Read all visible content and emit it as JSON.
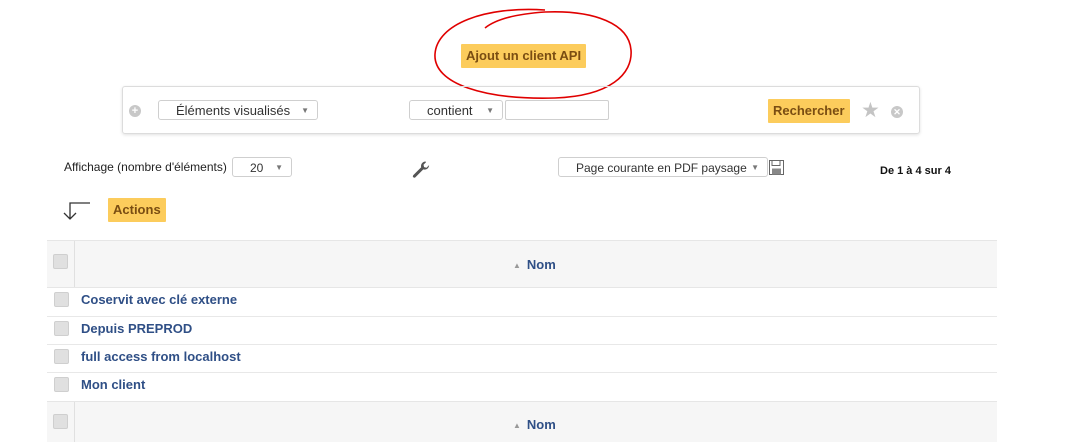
{
  "header": {
    "add_api_client_label": "Ajout un client API"
  },
  "filter": {
    "field_select": "Éléments visualisés",
    "operator_select": "contient",
    "value_input": "",
    "search_label": "Rechercher"
  },
  "toolbar": {
    "display_label": "Affichage (nombre d'éléments)",
    "page_size": "20",
    "export_select": "Page courante en PDF paysage",
    "pagination": "De 1 à 4 sur 4",
    "actions_label": "Actions"
  },
  "table": {
    "column_name": "Nom",
    "rows": [
      {
        "name": "Coservit avec clé externe"
      },
      {
        "name": "Depuis PREPROD"
      },
      {
        "name": "full access from localhost"
      },
      {
        "name": "Mon client"
      }
    ]
  },
  "colors": {
    "accent": "#fccc5c",
    "link": "#2f4f86",
    "annotation": "#e00000"
  }
}
